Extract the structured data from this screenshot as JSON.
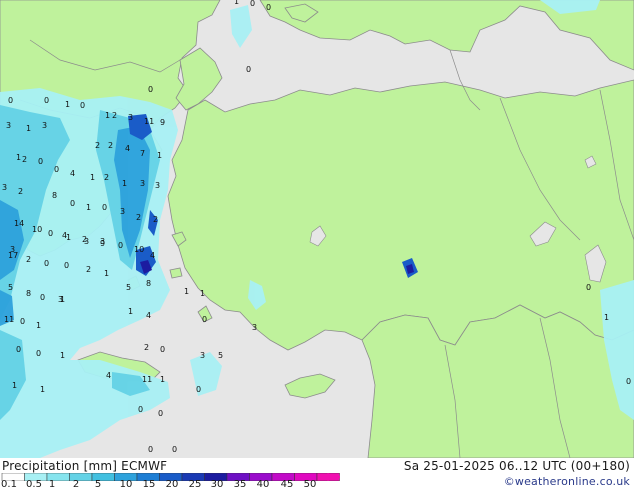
{
  "map": {
    "value_labels": [
      "3",
      "1",
      "0",
      "1",
      "0",
      "1",
      "0",
      "0",
      "2",
      "3",
      "11",
      "9",
      "3",
      "1",
      "0",
      "2",
      "2",
      "2",
      "4",
      "7",
      "1",
      "3",
      "2",
      "0",
      "4",
      "1",
      "2",
      "1",
      "3",
      "3",
      "8",
      "0",
      "1",
      "0",
      "3",
      "2",
      "2",
      "0",
      "1",
      "3",
      "9",
      "0",
      "3",
      "14",
      "10",
      "4",
      "2",
      "3",
      "10",
      "4",
      "17",
      "2",
      "0",
      "0",
      "2",
      "1",
      "5",
      "8",
      "3",
      "5",
      "8",
      "1",
      "1",
      "0",
      "11",
      "0",
      "1",
      "1",
      "1",
      "4",
      "0",
      "3",
      "0",
      "0",
      "1",
      "2",
      "0",
      "3",
      "5",
      "4",
      "11",
      "1",
      "1",
      "1",
      "0",
      "0",
      "0",
      "0",
      "0",
      "0",
      "1",
      "0",
      "0",
      "0",
      "1",
      "0"
    ]
  },
  "footer": {
    "title_left": "Precipitation [mm] ECMWF",
    "title_right": "Sa 25-01-2025 06..12 UTC (00+180)",
    "credit": "©weatheronline.co.uk"
  },
  "legend": {
    "labels": [
      "0.1",
      "0.5",
      "1",
      "2",
      "5",
      "10",
      "15",
      "20",
      "25",
      "30",
      "35",
      "40",
      "45",
      "50"
    ],
    "colors": [
      "#fefefe",
      "#a8f0f4",
      "#86e4ee",
      "#64d2e6",
      "#42c0e0",
      "#2ea2dc",
      "#1e7ed4",
      "#1a5cc8",
      "#1a3ab4",
      "#1c1ca0",
      "#6e10c4",
      "#9a0ccc",
      "#c20ac8",
      "#e008c0",
      "#f010b0"
    ]
  },
  "colors": {
    "land": "#bff29c",
    "sea": "#e6e6e6",
    "border": "#8c8c8c",
    "precip_light": "#a8f0f4",
    "precip_heavy": "#1a1ab4"
  }
}
